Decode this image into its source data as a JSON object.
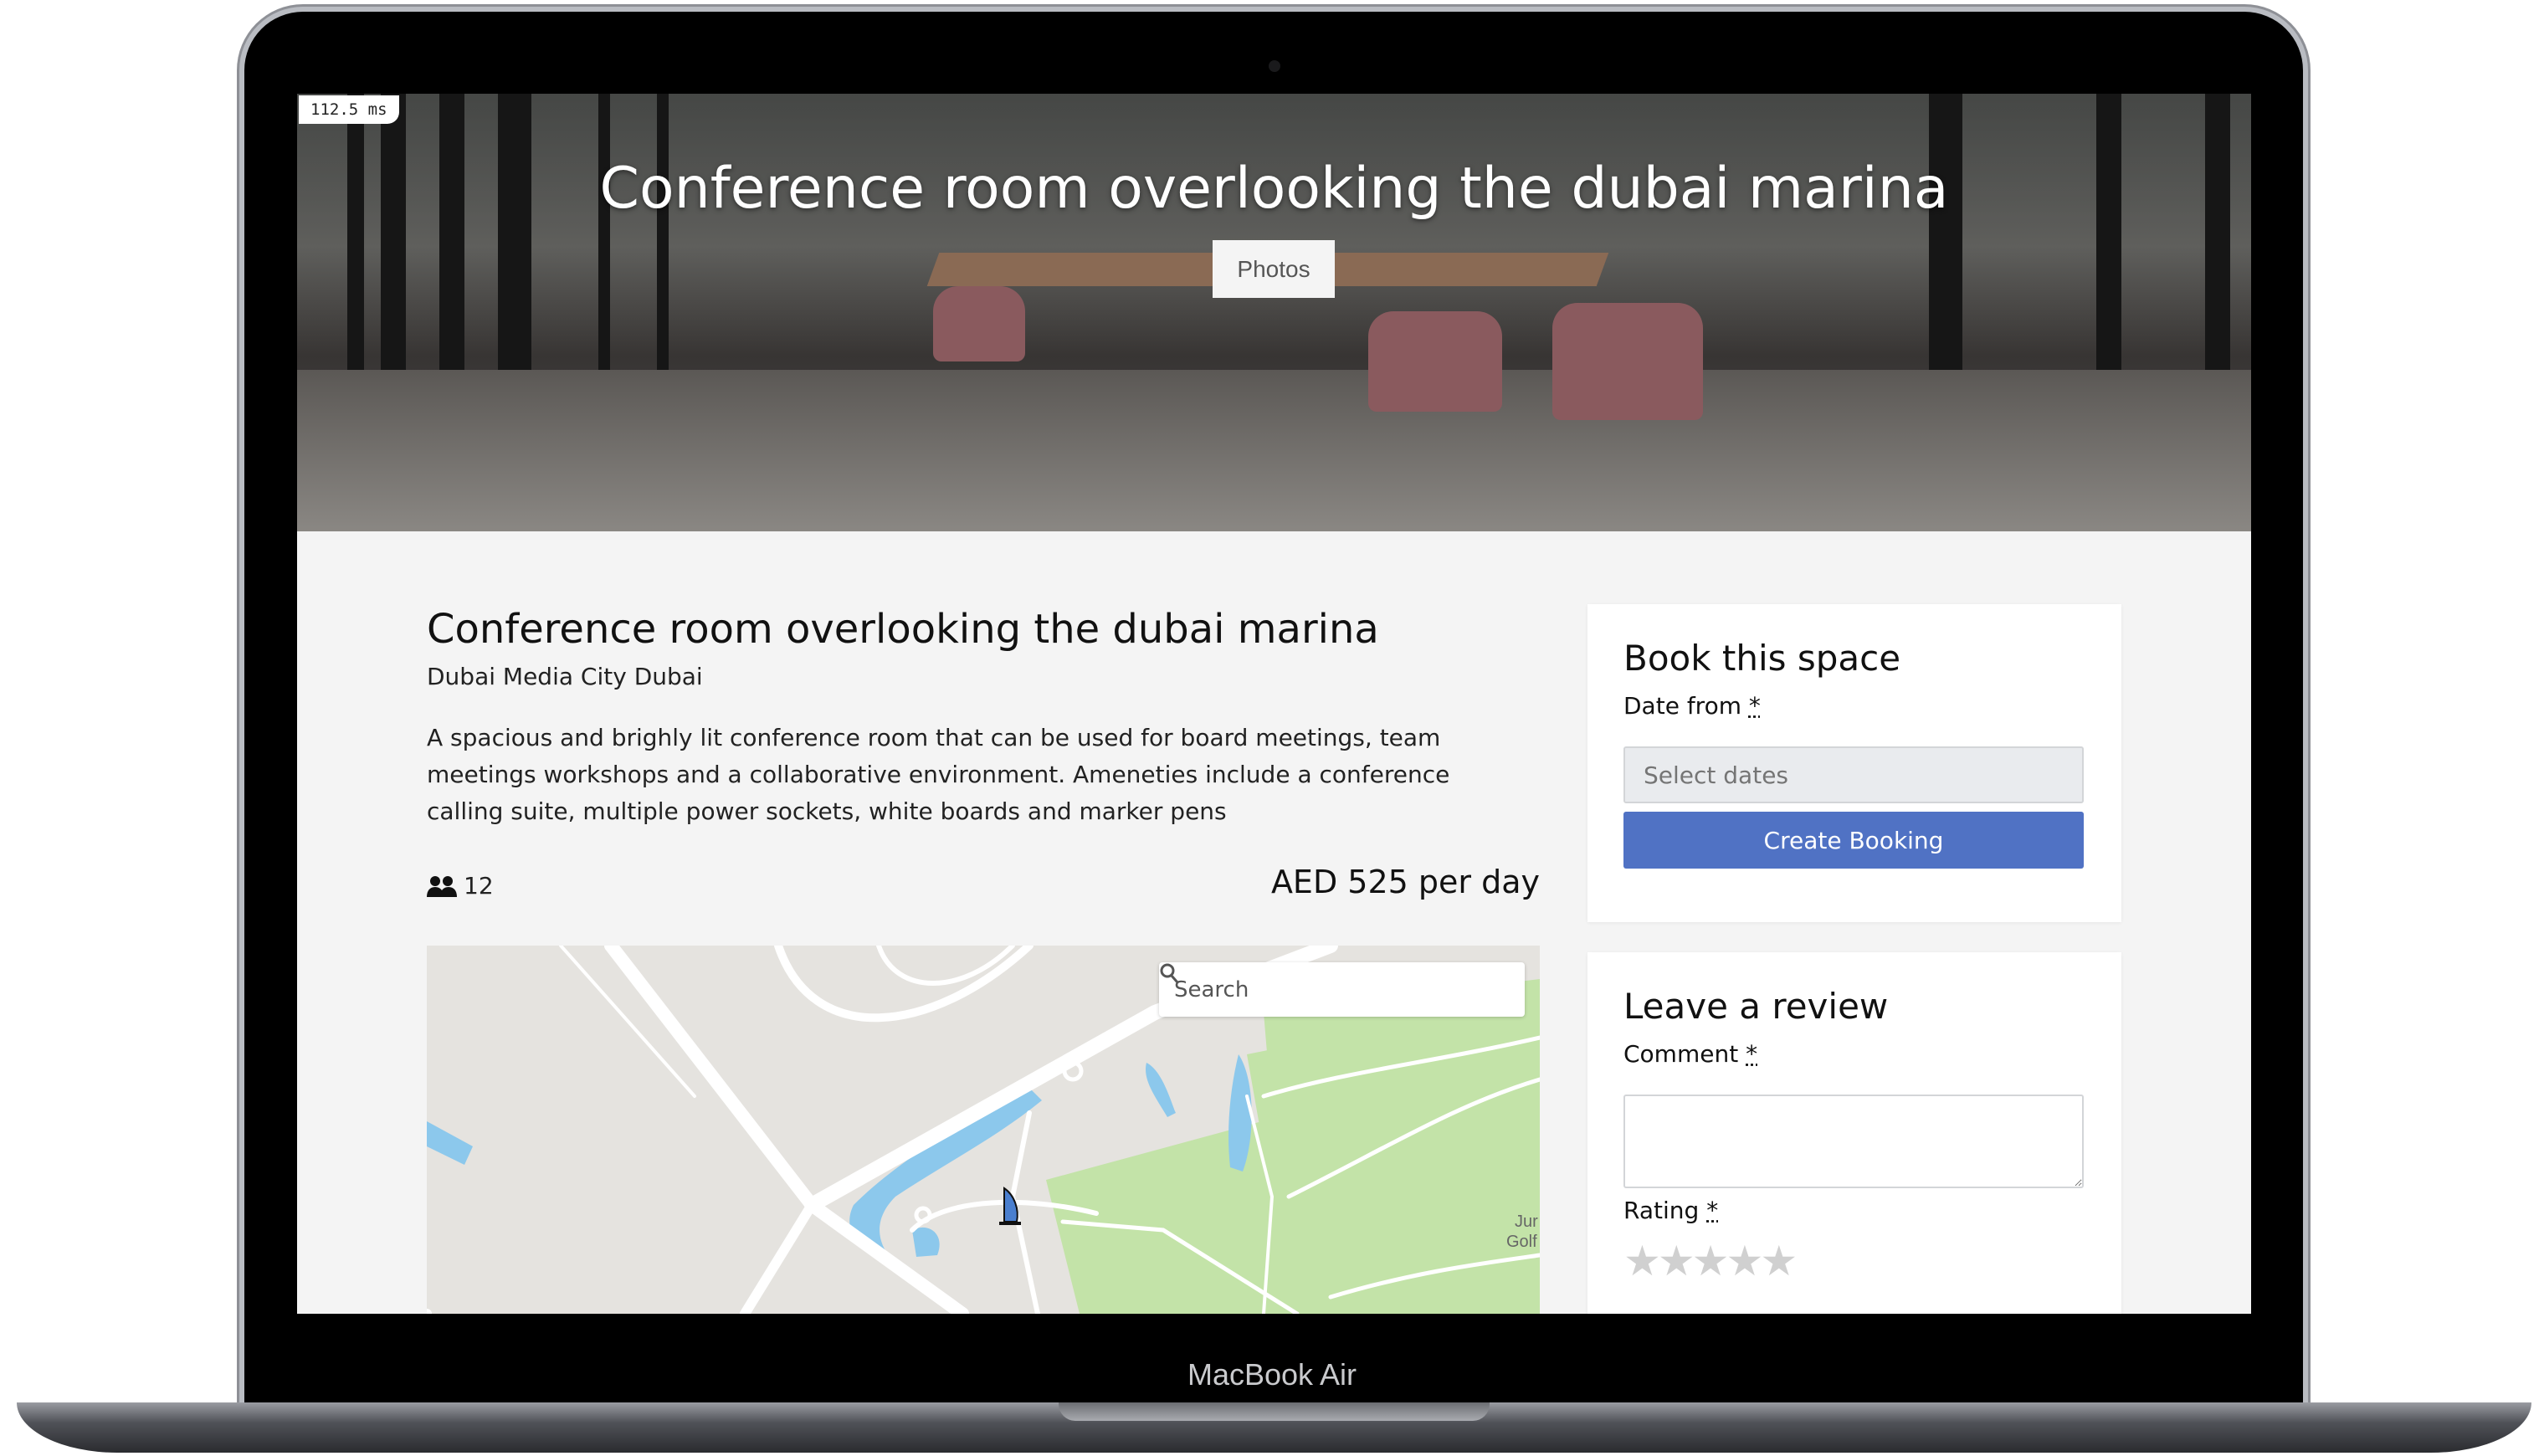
{
  "device": {
    "label": "MacBook Air"
  },
  "timer": {
    "value": "112.5 ms"
  },
  "hero": {
    "title": "Conference room overlooking the dubai marina",
    "photos_label": "Photos"
  },
  "listing": {
    "title": "Conference room overlooking the dubai marina",
    "location": "Dubai Media City Dubai",
    "description": "A spacious and brighly lit conference room that can be used for board meetings, team meetings workshops and a collaborative environment. Ameneties include a conference calling suite, multiple power sockets, white boards and marker pens",
    "capacity": "12",
    "price": "AED 525 per day"
  },
  "map": {
    "search_placeholder": "Search",
    "label_line1": "Jur",
    "label_line2": "Golf"
  },
  "booking": {
    "heading": "Book this space",
    "date_label": "Date from",
    "required_mark": "*",
    "date_placeholder": "Select dates",
    "submit_label": "Create Booking"
  },
  "review": {
    "heading": "Leave a review",
    "comment_label": "Comment",
    "rating_label": "Rating",
    "required_mark": "*",
    "rating_value": 0,
    "rating_max": 5
  },
  "colors": {
    "accent": "#5072c4",
    "page_bg": "#f4f4f4",
    "map_water": "#8cc8ec",
    "map_park": "#c3e3a8"
  }
}
